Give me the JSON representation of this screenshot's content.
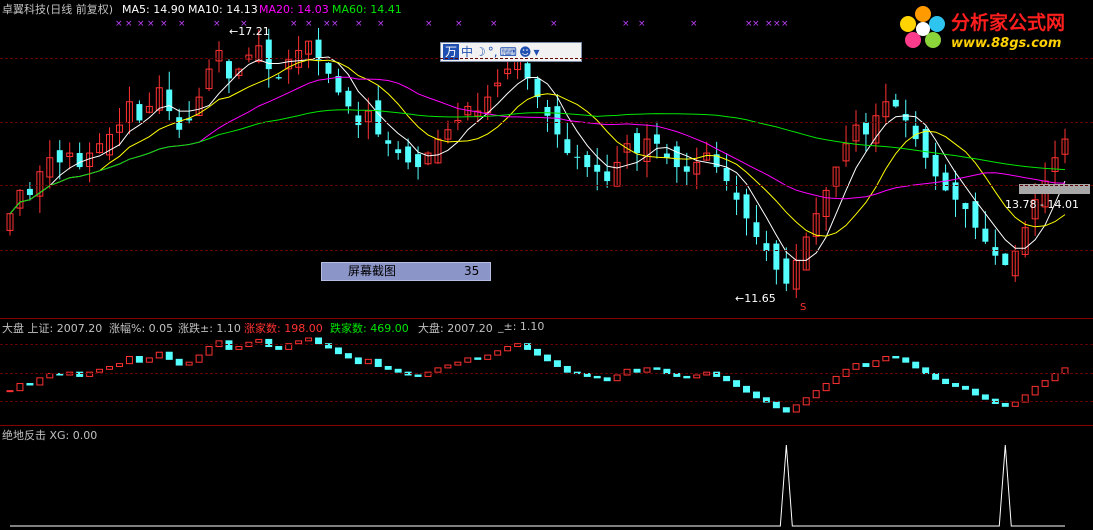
{
  "header": {
    "stock_title": "卓翼科技(日线 前复权)",
    "ma5": "MA5: 14.90",
    "ma10": "MA10: 14.13",
    "ma20": "MA20: 14.03",
    "ma60": "MA60: 14.41"
  },
  "colors": {
    "up": "#ff3232",
    "down": "#54ffff",
    "ma5": "#ffffff",
    "ma10": "#ffff00",
    "ma20": "#ff00ff",
    "ma60": "#00e600",
    "separator": "#8a0000",
    "grid": "#600000"
  },
  "annotations": {
    "high_price": "17.21",
    "low_price": "11.65",
    "right_range": "13.78 - 14.01",
    "s_marker": "S"
  },
  "screenshot_box": {
    "label": "屏幕截图",
    "count": "35"
  },
  "ime_toolbar": {
    "items": [
      "万",
      "中",
      "☽",
      "°,",
      "⌨",
      "☻",
      "▾"
    ]
  },
  "market_bar": {
    "index_label": "大盘 上证: 2007.20",
    "change_pct": "涨幅%: 0.05",
    "change": "涨跌±: 1.10",
    "rise_count": "涨家数: 198.00",
    "fall_count": "跌家数: 469.00",
    "index_repeat": "大盘: 2007.20",
    "pm": "_±: 1.10"
  },
  "indicator_bar": {
    "label": "绝地反击 XG: 0.00"
  },
  "logo": {
    "text": "分析家公式网",
    "url": "www.88gs.com"
  },
  "chart_data": [
    {
      "type": "candlestick",
      "name": "卓翼科技(日线 前复权)",
      "annotated_values": {
        "high": 17.21,
        "low": 11.65
      },
      "moving_averages": {
        "MA5": 14.9,
        "MA10": 14.13,
        "MA20": 14.03,
        "MA60": 14.41
      },
      "close": [
        13.3,
        13.8,
        13.7,
        14.2,
        14.5,
        14.4,
        14.6,
        14.3,
        14.6,
        14.8,
        15.0,
        15.2,
        15.7,
        15.3,
        15.6,
        16.0,
        15.5,
        15.1,
        15.3,
        15.8,
        16.4,
        16.8,
        16.2,
        16.4,
        16.7,
        16.9,
        16.4,
        16.2,
        16.6,
        16.8,
        17.0,
        16.6,
        16.3,
        15.9,
        15.6,
        15.2,
        15.5,
        15.0,
        14.8,
        14.6,
        14.4,
        14.3,
        14.6,
        14.9,
        15.1,
        15.3,
        15.6,
        15.5,
        15.8,
        16.1,
        16.4,
        16.6,
        16.2,
        15.8,
        15.4,
        15.0,
        14.6,
        14.5,
        14.3,
        14.2,
        14.0,
        14.4,
        14.8,
        14.6,
        14.9,
        14.8,
        14.5,
        14.3,
        14.2,
        14.4,
        14.6,
        14.3,
        14.0,
        13.6,
        13.2,
        12.8,
        12.5,
        12.1,
        11.8,
        12.3,
        12.8,
        13.3,
        13.8,
        14.3,
        14.8,
        15.2,
        15.0,
        15.4,
        15.7,
        15.6,
        15.3,
        14.9,
        14.5,
        14.1,
        13.8,
        13.6,
        13.4,
        13.0,
        12.7,
        12.4,
        12.2,
        12.5,
        13.0,
        13.6,
        14.0,
        14.5,
        14.9
      ]
    },
    {
      "type": "candlestick",
      "name": "大盘 上证",
      "index_value": 2007.2,
      "change_pct": 0.05,
      "change": 1.1
    },
    {
      "type": "line",
      "name": "绝地反击",
      "value": 0.0,
      "signals": [
        0,
        0,
        0,
        0,
        0,
        0,
        0,
        0,
        0,
        0,
        0,
        0,
        0,
        0,
        0,
        0,
        0,
        0,
        0,
        0,
        0,
        0,
        0,
        0,
        0,
        0,
        0,
        0,
        0,
        0,
        0,
        0,
        0,
        0,
        0,
        0,
        0,
        0,
        0,
        0,
        0,
        0,
        0,
        0,
        0,
        0,
        0,
        0,
        0,
        0,
        0,
        0,
        0,
        0,
        0,
        0,
        0,
        0,
        0,
        0,
        0,
        0,
        0,
        0,
        0,
        0,
        0,
        0,
        0,
        0,
        0,
        0,
        0,
        0,
        0,
        0,
        0,
        0,
        1,
        0,
        0,
        0,
        0,
        0,
        0,
        0,
        0,
        0,
        0,
        0,
        0,
        0,
        0,
        0,
        0,
        0,
        0,
        0,
        0,
        0,
        1,
        0,
        0,
        0,
        0,
        0,
        0
      ]
    }
  ]
}
